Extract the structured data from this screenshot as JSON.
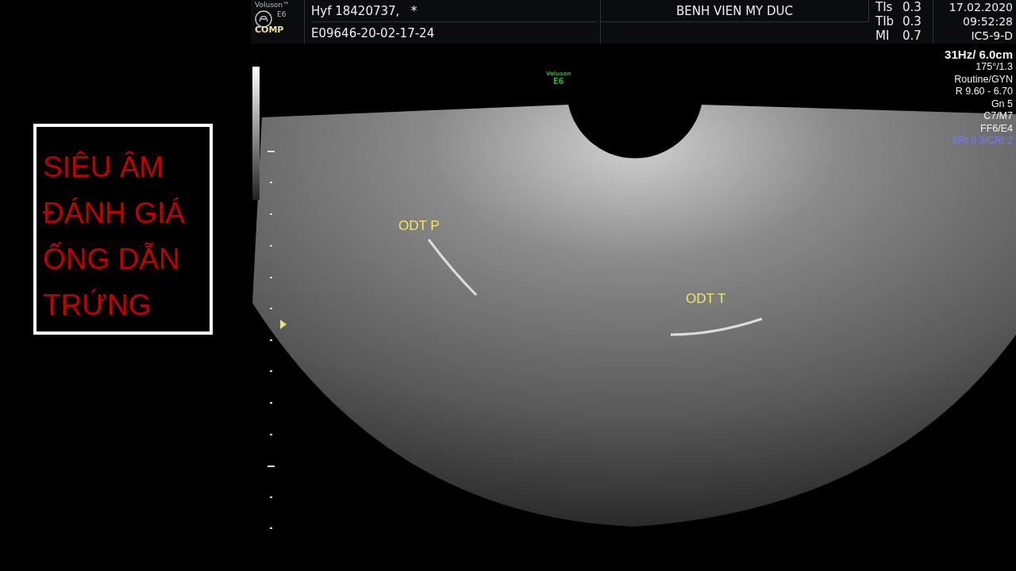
{
  "title": "SIÊU ÂM ĐÁNH GIÁ ỐNG DẪN TRỨNG",
  "header": {
    "brand": "Voluson™",
    "model": "E6",
    "mode": "COMP",
    "patient": "Hyf 18420737,   *",
    "exam_id": "E09646-20-02-17-24",
    "hospital": "BENH VIEN MY DUC",
    "indices": [
      {
        "label": "TIs",
        "value": "0.3"
      },
      {
        "label": "TIb",
        "value": "0.3"
      },
      {
        "label": "MI",
        "value": "0.7"
      }
    ],
    "date": "17.02.2020",
    "time": "09:52:28",
    "probe": "IC5-9-D"
  },
  "parameters": [
    {
      "text": "31Hz/ 6.0cm",
      "color": "#f0f0f0"
    },
    {
      "text": "175°/1.3",
      "color": "#f0f0f0"
    },
    {
      "text": "Routine/GYN",
      "color": "#f0f0f0"
    },
    {
      "text": "R 9.60 - 6.70",
      "color": "#f0f0f0"
    },
    {
      "text": "Gn  5",
      "color": "#f0f0f0"
    },
    {
      "text": "C7/M7",
      "color": "#f0f0f0"
    },
    {
      "text": "FF6/E4",
      "color": "#f0f0f0"
    },
    {
      "text": "SRI II 3/CRI 2",
      "color": "#7b7bf0"
    }
  ],
  "image": {
    "brand": "Voluson",
    "model": "E6",
    "annotations": [
      {
        "text": "ODT P"
      },
      {
        "text": "ODT T"
      }
    ]
  }
}
